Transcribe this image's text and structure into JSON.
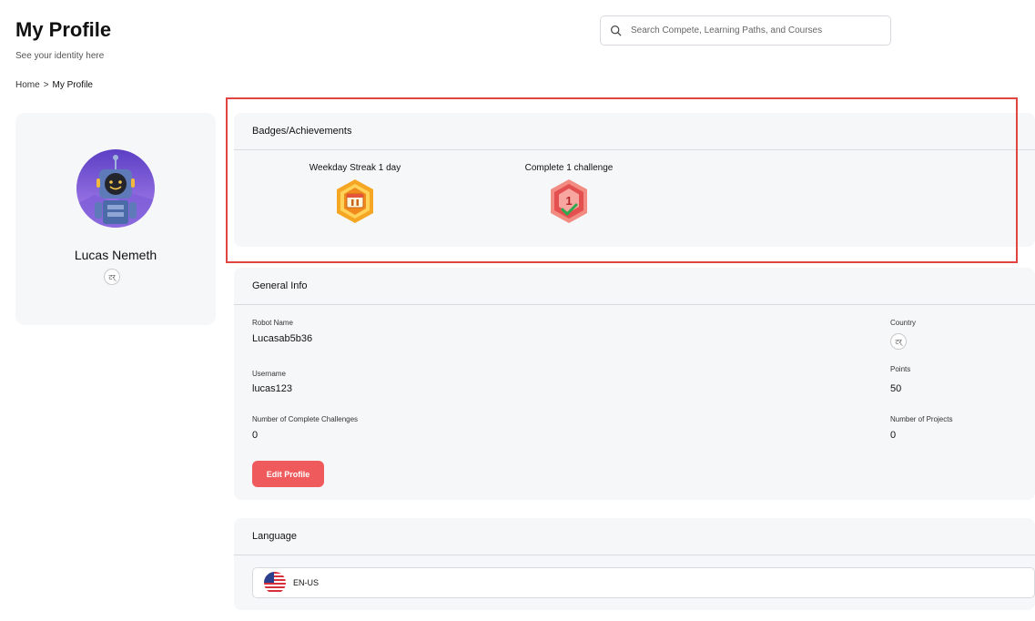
{
  "header": {
    "title": "My Profile",
    "subtitle": "See your identity here"
  },
  "breadcrumb": {
    "home": "Home",
    "separator": ">",
    "current": "My Profile"
  },
  "search": {
    "placeholder": "Search Compete, Learning Paths, and Courses",
    "icon": "search-icon"
  },
  "profile": {
    "name": "Lucas Nemeth",
    "avatar": "robot-avatar",
    "country_flag_placeholder": "टर्"
  },
  "badges": {
    "title": "Badges/Achievements",
    "items": [
      {
        "label": "Weekday Streak 1 day",
        "icon": "streak-badge-icon"
      },
      {
        "label": "Complete 1 challenge",
        "icon": "challenge-badge-icon"
      }
    ]
  },
  "general_info": {
    "title": "General Info",
    "robot_name_label": "Robot Name",
    "robot_name": "Lucasab5b36",
    "username_label": "Username",
    "username": "lucas123",
    "challenges_label": "Number of Complete Challenges",
    "challenges": "0",
    "country_label": "Country",
    "country_flag_placeholder": "टर्",
    "points_label": "Points",
    "points": "50",
    "projects_label": "Number of Projects",
    "projects": "0",
    "edit_label": "Edit Profile"
  },
  "language": {
    "title": "Language",
    "selected": "EN-US"
  },
  "colors": {
    "accent": "#ef5a5c",
    "highlight": "#e0463f",
    "card_bg": "#f6f7f9"
  }
}
